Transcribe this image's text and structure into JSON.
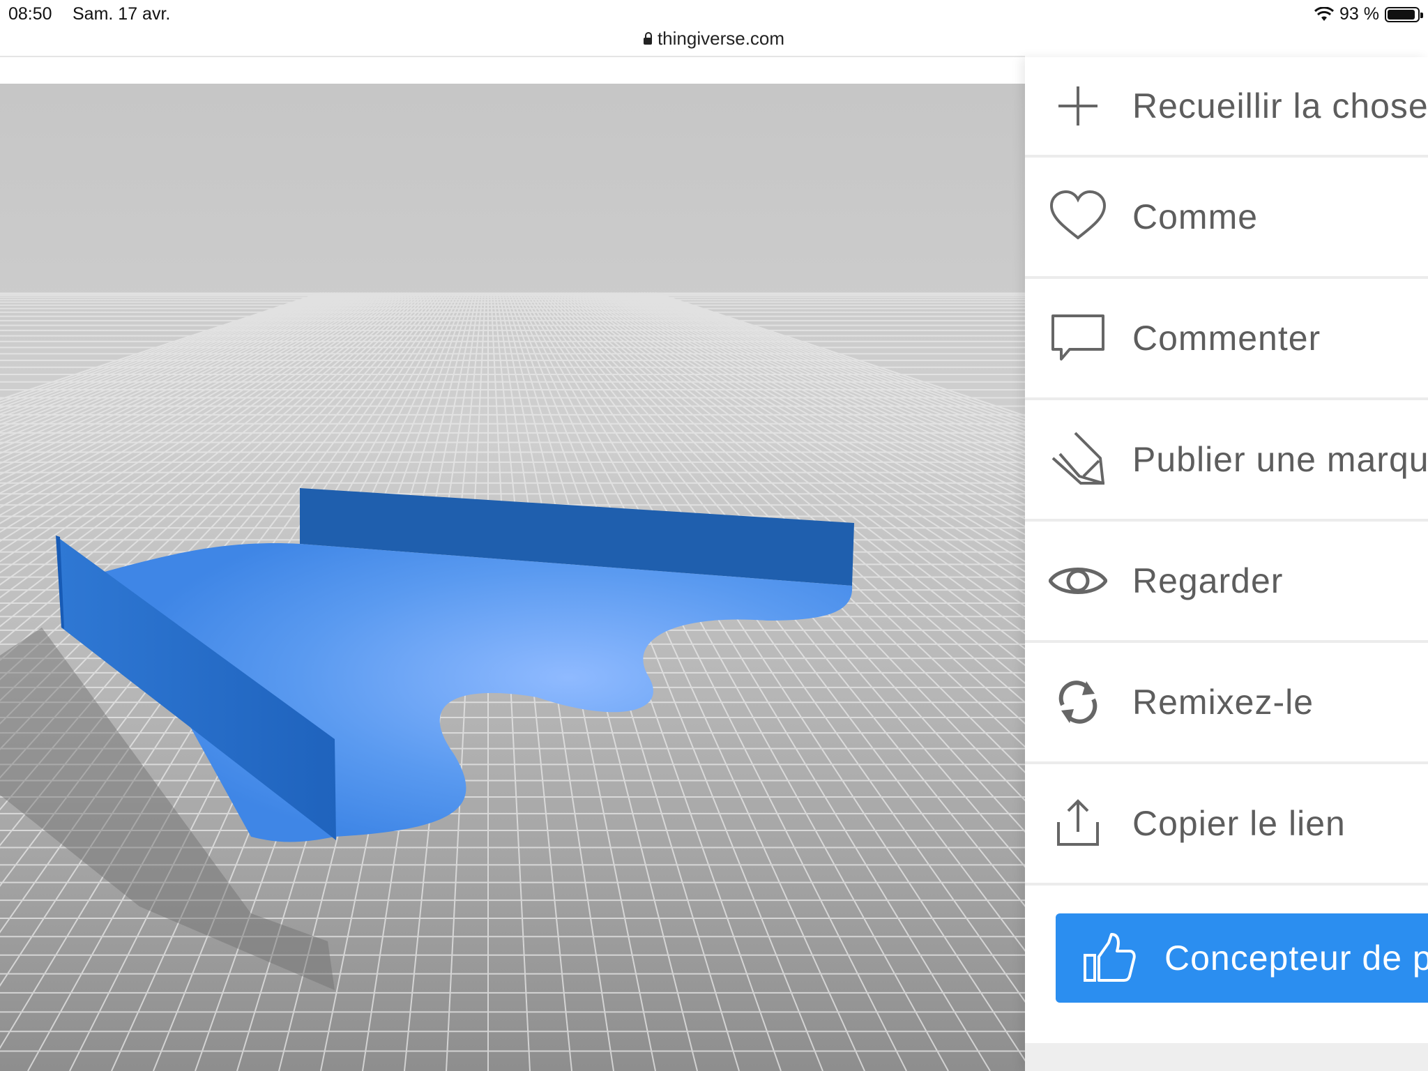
{
  "status_bar": {
    "time": "08:50",
    "date": "Sam. 17 avr.",
    "battery_text": "93 %",
    "battery_level": 0.93
  },
  "browser": {
    "url": "thingiverse.com"
  },
  "viewer": {
    "model_color": "#3a86e6",
    "background_color": "#c9c9c9"
  },
  "menu": {
    "items": [
      {
        "label": "Recueillir la chose",
        "icon": "plus-icon"
      },
      {
        "label": "Comme",
        "icon": "heart-icon"
      },
      {
        "label": "Commenter",
        "icon": "comment-icon"
      },
      {
        "label": "Publier une marque",
        "icon": "pencil-icon"
      },
      {
        "label": "Regarder",
        "icon": "eye-icon"
      },
      {
        "label": "Remixez-le",
        "icon": "remix-icon"
      },
      {
        "label": "Copier le lien",
        "icon": "share-icon"
      }
    ],
    "cta": {
      "label": "Concepteur de p",
      "icon": "thumbs-up-icon",
      "color": "#2b8ef0"
    }
  }
}
